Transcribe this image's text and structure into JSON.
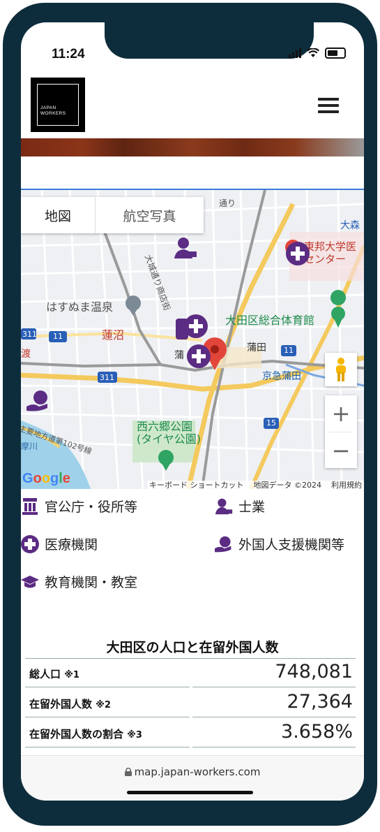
{
  "status_bar": {
    "time": "11:24"
  },
  "header": {
    "logo_line1": "JAPAN",
    "logo_line2": "WORKERS"
  },
  "map": {
    "tabs": [
      "地図",
      "航空写真"
    ],
    "labels": {
      "hasunuma_onsen": "はすぬま温泉",
      "hasunuma": "蓮沼",
      "ota_gym": "大田区総合体育館",
      "kamata": "蒲田",
      "keikyu_kamata": "京急蒲田",
      "nishirokugo_park_1": "西六郷公園",
      "nishirokugo_park_2": "(タイヤ公園)",
      "toho_univ_1": "東邦大学医",
      "toho_univ_2": "センター",
      "omori": "大森",
      "shopping_st": "大城通り商店街",
      "road_311a": "311",
      "road_11a": "11",
      "road_311b": "311",
      "road_11b": "11",
      "road_15": "15",
      "watari": "渡",
      "kamata_small": "蒲",
      "dori": "通り",
      "shuyo": "主要地方道",
      "route": "第102号線",
      "tama": "摩川"
    },
    "google_logo": "Google",
    "attribution": {
      "shortcuts": "キーボード ショートカット",
      "data": "地図データ ©2024",
      "terms": "利用規約"
    },
    "zoom_in": "+",
    "zoom_out": "−"
  },
  "legend": {
    "government": "官公庁・役所等",
    "professionals": "士業",
    "medical": "医療機関",
    "foreign_support": "外国人支援機関等",
    "education": "教育機関・教室"
  },
  "stats": {
    "title": "大田区の人口と在留外国人数",
    "rows": [
      {
        "label": "総人口",
        "note": "※1",
        "value": "748,081"
      },
      {
        "label": "在留外国人数",
        "note": "※2",
        "value": "27,364"
      },
      {
        "label": "在留外国人数の割合",
        "note": "※3",
        "value": "3.658%"
      }
    ]
  },
  "browser": {
    "url": "map.japan-workers.com"
  },
  "colors": {
    "frame": "#0e2d3c",
    "poi": "#5b2c83",
    "link_line": "#3a7bd5"
  }
}
